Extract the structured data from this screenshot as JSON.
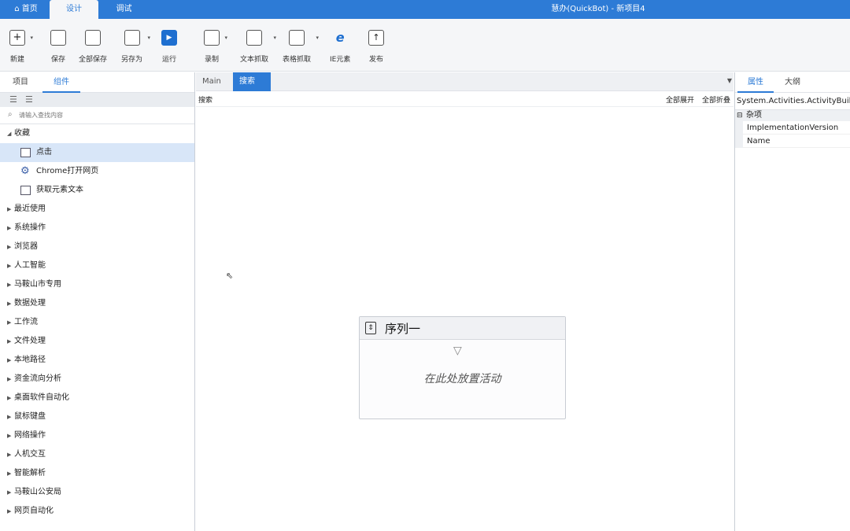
{
  "titlebar": {
    "tabs": [
      {
        "label": "首页",
        "icon": "home-icon"
      },
      {
        "label": "设计"
      },
      {
        "label": "调试"
      }
    ],
    "app_title": "慧办(QuickBot) - 新项目4"
  },
  "toolbar": {
    "buttons": [
      {
        "label": "新建",
        "icon": "new-icon"
      },
      {
        "label": "保存",
        "icon": "save-icon"
      },
      {
        "label": "全部保存",
        "icon": "save-all-icon"
      },
      {
        "label": "另存为",
        "icon": "save-as-icon"
      },
      {
        "label": "运行",
        "icon": "run-icon"
      },
      {
        "label": "录制",
        "icon": "record-icon"
      },
      {
        "label": "文本抓取",
        "icon": "text-scrape-icon"
      },
      {
        "label": "表格抓取",
        "icon": "table-scrape-icon"
      },
      {
        "label": "IE元素",
        "icon": "ie-icon"
      },
      {
        "label": "发布",
        "icon": "publish-icon"
      }
    ]
  },
  "left_panel": {
    "tabs": [
      "项目",
      "组件"
    ],
    "active_tab": "组件",
    "search_placeholder": "请输入查找内容",
    "favorites_label": "收藏",
    "favorites": [
      {
        "label": "点击",
        "icon": "click-icon",
        "selected": true
      },
      {
        "label": "Chrome打开网页",
        "icon": "chrome-gear-icon"
      },
      {
        "label": "获取元素文本",
        "icon": "get-text-icon"
      }
    ],
    "categories": [
      "最近使用",
      "系统操作",
      "浏览器",
      "人工智能",
      "马鞍山市专用",
      "数据处理",
      "工作流",
      "文件处理",
      "本地路径",
      "资金流向分析",
      "桌面软件自动化",
      "鼠标键盘",
      "网络操作",
      "人机交互",
      "智能解析",
      "马鞍山公安局",
      "网页自动化"
    ]
  },
  "center": {
    "tabs": [
      {
        "label": "Main"
      },
      {
        "label": "搜索 *",
        "active": true
      }
    ],
    "breadcrumb": "搜索",
    "expand_all": "全部展开",
    "collapse_all": "全部折叠",
    "sequence": {
      "title": "序列一",
      "hint": "在此处放置活动"
    }
  },
  "right_panel": {
    "tabs": [
      "属性",
      "大纲"
    ],
    "type_name": "System.Activities.ActivityBuilder",
    "category": "杂项",
    "properties": [
      "ImplementationVersion",
      "Name"
    ]
  },
  "colors": {
    "accent": "#2d7bd6",
    "selected_row": "#d8e6f8"
  }
}
